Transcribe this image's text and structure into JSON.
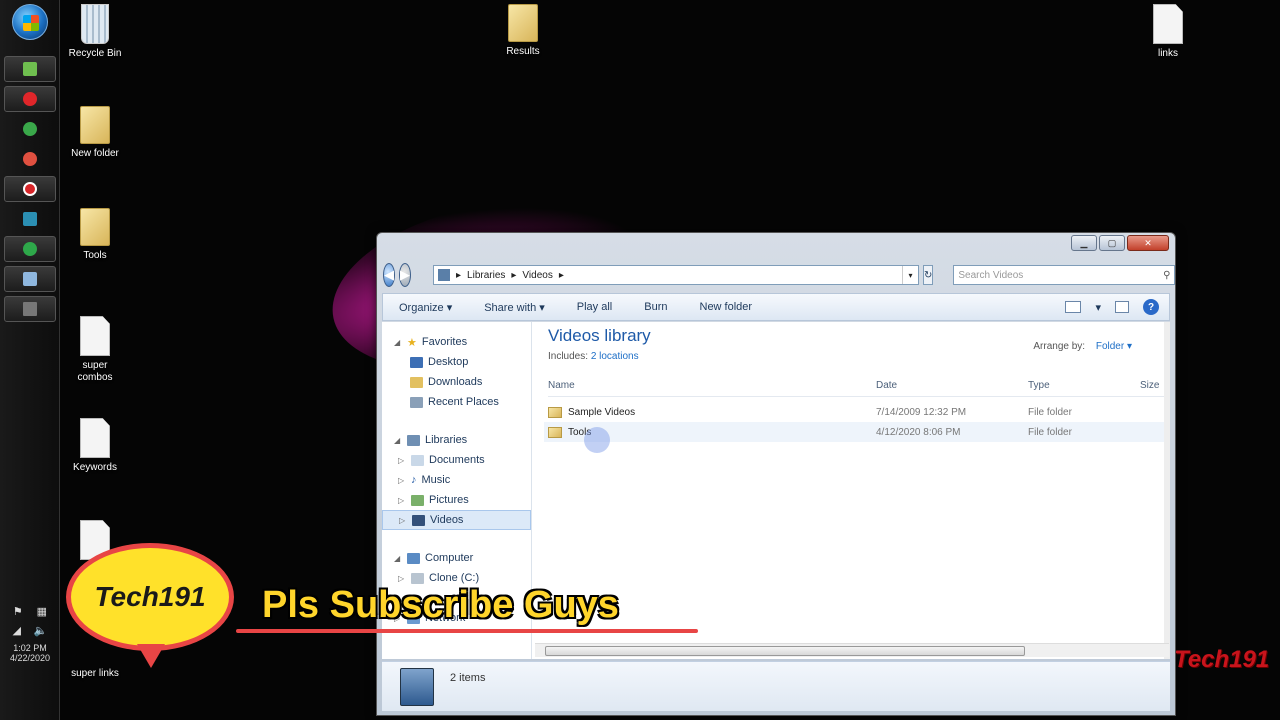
{
  "desktop": {
    "icons": [
      {
        "label": "Recycle Bin",
        "type": "bin"
      },
      {
        "label": "Results",
        "type": "folder"
      },
      {
        "label": "links",
        "type": "doc"
      },
      {
        "label": "New folder",
        "type": "folder"
      },
      {
        "label": "Tools",
        "type": "folder"
      },
      {
        "label": "super\ncombos",
        "type": "doc"
      },
      {
        "label": "Keywords",
        "type": "doc"
      },
      {
        "label": "super links",
        "type": "doc"
      }
    ]
  },
  "taskbar": {
    "time": "1:02 PM",
    "date": "4/22/2020"
  },
  "window": {
    "address": {
      "parts": [
        "Libraries",
        "Videos"
      ]
    },
    "search_placeholder": "Search Videos",
    "toolbar": {
      "organize": "Organize ▾",
      "share_with": "Share with ▾",
      "play_all": "Play all",
      "burn": "Burn",
      "new_folder": "New folder"
    },
    "navpane": {
      "favorites": "Favorites",
      "desktop": "Desktop",
      "downloads": "Downloads",
      "recent": "Recent Places",
      "libraries": "Libraries",
      "documents": "Documents",
      "music": "Music",
      "pictures": "Pictures",
      "videos": "Videos",
      "computer": "Computer",
      "clone": "Clone (C:)",
      "network": "Network"
    },
    "library": {
      "title": "Videos library",
      "includes_label": "Includes:",
      "includes_link": "2 locations",
      "arrange_by": "Arrange by:",
      "arrange_value": "Folder ▾"
    },
    "columns": {
      "name": "Name",
      "date": "Date",
      "type": "Type",
      "size": "Size"
    },
    "rows": [
      {
        "name": "Sample Videos",
        "date": "7/14/2009 12:32 PM",
        "type": "File folder"
      },
      {
        "name": "Tools",
        "date": "4/12/2020 8:06 PM",
        "type": "File folder"
      }
    ],
    "status": "2 items"
  },
  "overlay": {
    "badge": "Tech191",
    "subscribe": "Pls Subscribe Guys",
    "watermark": "Tech191"
  }
}
